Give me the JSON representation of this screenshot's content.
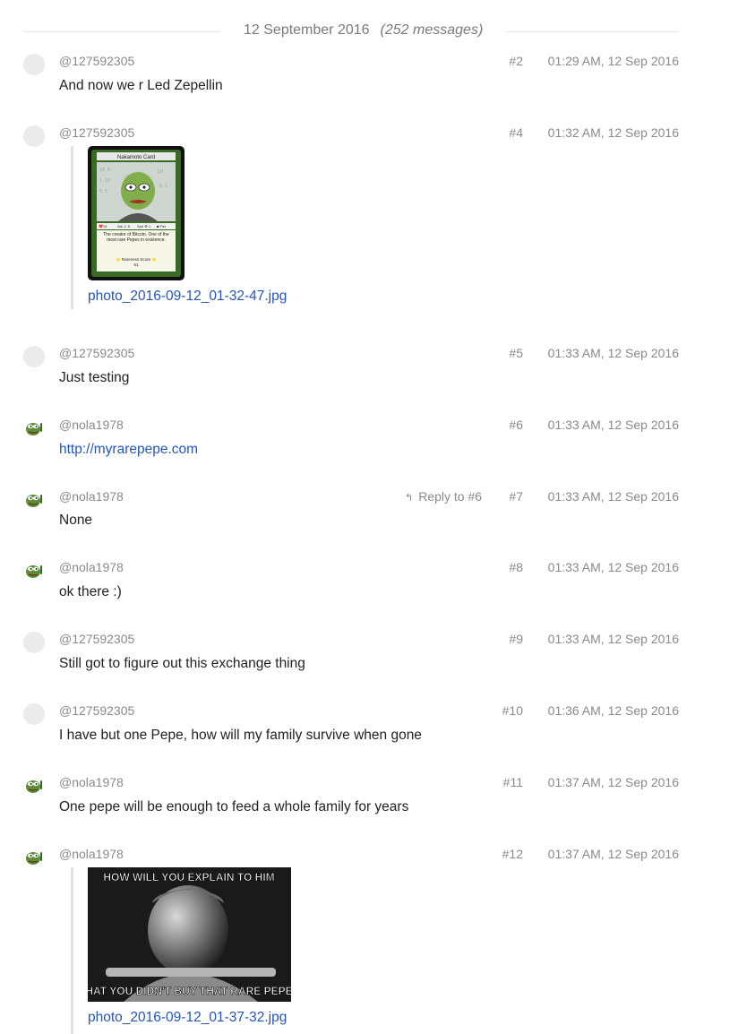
{
  "day_header": {
    "date": "12 September 2016",
    "count": "(252 messages)"
  },
  "messages": [
    {
      "author": "@127592305",
      "num": "#2",
      "time": "01:29 AM, 12 Sep 2016",
      "text": "And now we r Led Zepellin"
    },
    {
      "author": "@127592305",
      "num": "#4",
      "time": "01:32 AM, 12 Sep 2016",
      "file": "photo_2016-09-12_01-32-47.jpg",
      "card": {
        "title": "Nakamoto Card",
        "stats": [
          "❤️15",
          "Atk ⚔ 5",
          "Spd ⚙ 1",
          "■ Fire"
        ],
        "desc": "The creator of Bitcoin. One of the most rare Pepes in existence.",
        "footer": "⭐ Rareness Score ⭐",
        "footer_num": "61"
      }
    },
    {
      "author": "@127592305",
      "num": "#5",
      "time": "01:33 AM, 12 Sep 2016",
      "text": "Just testing"
    },
    {
      "author": "@nola1978",
      "num": "#6",
      "time": "01:33 AM, 12 Sep 2016",
      "link": "http://myrarepepe.com"
    },
    {
      "author": "@nola1978",
      "num": "#7",
      "time": "01:33 AM, 12 Sep 2016",
      "reply": "Reply to #6",
      "text": "None"
    },
    {
      "author": "@nola1978",
      "num": "#8",
      "time": "01:33 AM, 12 Sep 2016",
      "text": "ok there :)"
    },
    {
      "author": "@127592305",
      "num": "#9",
      "time": "01:33 AM, 12 Sep 2016",
      "text": "Still got to figure out this exchange thing"
    },
    {
      "author": "@127592305",
      "num": "#10",
      "time": "01:36 AM, 12 Sep 2016",
      "text": "I have but one Pepe, how will my family survive when gone"
    },
    {
      "author": "@nola1978",
      "num": "#11",
      "time": "01:37 AM, 12 Sep 2016",
      "text": "One pepe will be enough to feed a whole family for years"
    },
    {
      "author": "@nola1978",
      "num": "#12",
      "time": "01:37 AM, 12 Sep 2016",
      "file": "photo_2016-09-12_01-37-32.jpg",
      "meme": {
        "top": "HOW WILL YOU EXPLAIN TO HIM",
        "bottom": "THAT YOU DIDN'T BUY THAT RARE PEPE?"
      }
    }
  ],
  "icons": {
    "reply": "reply-arrow-icon",
    "avatar_pepe": "pepe-avatar-icon"
  },
  "colors": {
    "link": "#2456b8",
    "meta": "#8a8a8a",
    "avatar_placeholder": "#ebebeb"
  }
}
